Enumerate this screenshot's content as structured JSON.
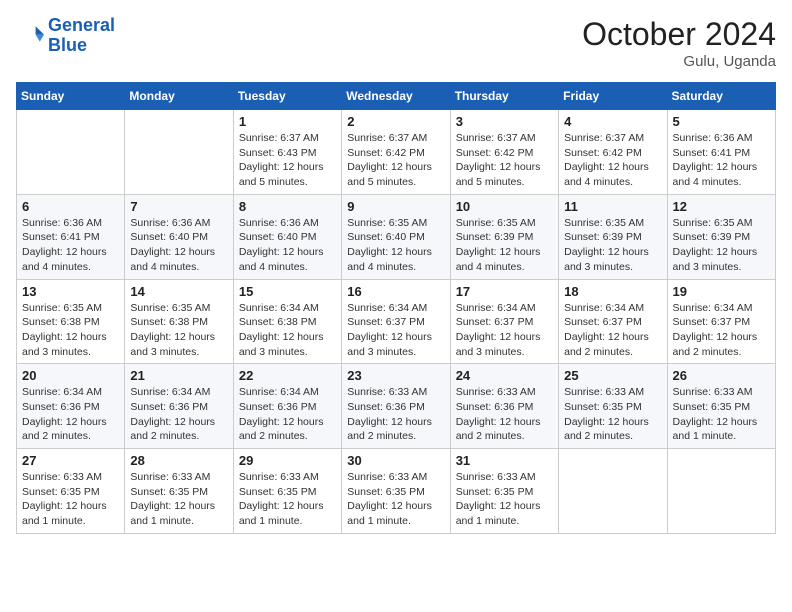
{
  "logo": {
    "line1": "General",
    "line2": "Blue"
  },
  "title": "October 2024",
  "location": "Gulu, Uganda",
  "days_header": [
    "Sunday",
    "Monday",
    "Tuesday",
    "Wednesday",
    "Thursday",
    "Friday",
    "Saturday"
  ],
  "weeks": [
    [
      {
        "day": "",
        "info": ""
      },
      {
        "day": "",
        "info": ""
      },
      {
        "day": "1",
        "info": "Sunrise: 6:37 AM\nSunset: 6:43 PM\nDaylight: 12 hours and 5 minutes."
      },
      {
        "day": "2",
        "info": "Sunrise: 6:37 AM\nSunset: 6:42 PM\nDaylight: 12 hours and 5 minutes."
      },
      {
        "day": "3",
        "info": "Sunrise: 6:37 AM\nSunset: 6:42 PM\nDaylight: 12 hours and 5 minutes."
      },
      {
        "day": "4",
        "info": "Sunrise: 6:37 AM\nSunset: 6:42 PM\nDaylight: 12 hours and 4 minutes."
      },
      {
        "day": "5",
        "info": "Sunrise: 6:36 AM\nSunset: 6:41 PM\nDaylight: 12 hours and 4 minutes."
      }
    ],
    [
      {
        "day": "6",
        "info": "Sunrise: 6:36 AM\nSunset: 6:41 PM\nDaylight: 12 hours and 4 minutes."
      },
      {
        "day": "7",
        "info": "Sunrise: 6:36 AM\nSunset: 6:40 PM\nDaylight: 12 hours and 4 minutes."
      },
      {
        "day": "8",
        "info": "Sunrise: 6:36 AM\nSunset: 6:40 PM\nDaylight: 12 hours and 4 minutes."
      },
      {
        "day": "9",
        "info": "Sunrise: 6:35 AM\nSunset: 6:40 PM\nDaylight: 12 hours and 4 minutes."
      },
      {
        "day": "10",
        "info": "Sunrise: 6:35 AM\nSunset: 6:39 PM\nDaylight: 12 hours and 4 minutes."
      },
      {
        "day": "11",
        "info": "Sunrise: 6:35 AM\nSunset: 6:39 PM\nDaylight: 12 hours and 3 minutes."
      },
      {
        "day": "12",
        "info": "Sunrise: 6:35 AM\nSunset: 6:39 PM\nDaylight: 12 hours and 3 minutes."
      }
    ],
    [
      {
        "day": "13",
        "info": "Sunrise: 6:35 AM\nSunset: 6:38 PM\nDaylight: 12 hours and 3 minutes."
      },
      {
        "day": "14",
        "info": "Sunrise: 6:35 AM\nSunset: 6:38 PM\nDaylight: 12 hours and 3 minutes."
      },
      {
        "day": "15",
        "info": "Sunrise: 6:34 AM\nSunset: 6:38 PM\nDaylight: 12 hours and 3 minutes."
      },
      {
        "day": "16",
        "info": "Sunrise: 6:34 AM\nSunset: 6:37 PM\nDaylight: 12 hours and 3 minutes."
      },
      {
        "day": "17",
        "info": "Sunrise: 6:34 AM\nSunset: 6:37 PM\nDaylight: 12 hours and 3 minutes."
      },
      {
        "day": "18",
        "info": "Sunrise: 6:34 AM\nSunset: 6:37 PM\nDaylight: 12 hours and 2 minutes."
      },
      {
        "day": "19",
        "info": "Sunrise: 6:34 AM\nSunset: 6:37 PM\nDaylight: 12 hours and 2 minutes."
      }
    ],
    [
      {
        "day": "20",
        "info": "Sunrise: 6:34 AM\nSunset: 6:36 PM\nDaylight: 12 hours and 2 minutes."
      },
      {
        "day": "21",
        "info": "Sunrise: 6:34 AM\nSunset: 6:36 PM\nDaylight: 12 hours and 2 minutes."
      },
      {
        "day": "22",
        "info": "Sunrise: 6:34 AM\nSunset: 6:36 PM\nDaylight: 12 hours and 2 minutes."
      },
      {
        "day": "23",
        "info": "Sunrise: 6:33 AM\nSunset: 6:36 PM\nDaylight: 12 hours and 2 minutes."
      },
      {
        "day": "24",
        "info": "Sunrise: 6:33 AM\nSunset: 6:36 PM\nDaylight: 12 hours and 2 minutes."
      },
      {
        "day": "25",
        "info": "Sunrise: 6:33 AM\nSunset: 6:35 PM\nDaylight: 12 hours and 2 minutes."
      },
      {
        "day": "26",
        "info": "Sunrise: 6:33 AM\nSunset: 6:35 PM\nDaylight: 12 hours and 1 minute."
      }
    ],
    [
      {
        "day": "27",
        "info": "Sunrise: 6:33 AM\nSunset: 6:35 PM\nDaylight: 12 hours and 1 minute."
      },
      {
        "day": "28",
        "info": "Sunrise: 6:33 AM\nSunset: 6:35 PM\nDaylight: 12 hours and 1 minute."
      },
      {
        "day": "29",
        "info": "Sunrise: 6:33 AM\nSunset: 6:35 PM\nDaylight: 12 hours and 1 minute."
      },
      {
        "day": "30",
        "info": "Sunrise: 6:33 AM\nSunset: 6:35 PM\nDaylight: 12 hours and 1 minute."
      },
      {
        "day": "31",
        "info": "Sunrise: 6:33 AM\nSunset: 6:35 PM\nDaylight: 12 hours and 1 minute."
      },
      {
        "day": "",
        "info": ""
      },
      {
        "day": "",
        "info": ""
      }
    ]
  ]
}
